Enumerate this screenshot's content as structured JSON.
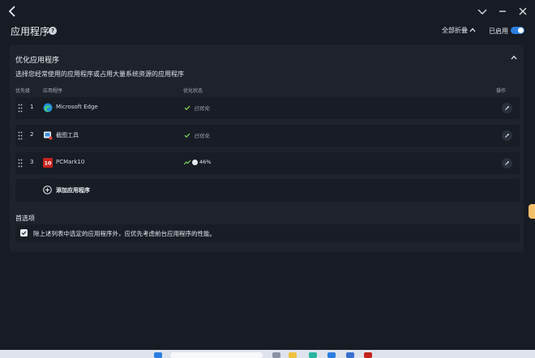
{
  "page": {
    "title": "应用程序",
    "collapse_all": "全部折叠",
    "enabled_label": "已启用"
  },
  "section": {
    "title": "优化应用程序",
    "subtitle": "选择您经常使用的应用程序或占用大量系统资源的应用程序"
  },
  "columns": {
    "priority": "优先级",
    "app": "应用程序",
    "status": "优化状态",
    "operation": "操作"
  },
  "rows": [
    {
      "num": "1",
      "name": "Microsoft Edge",
      "status": "已优化",
      "icon": "edge-icon"
    },
    {
      "num": "2",
      "name": "截图工具",
      "status": "已优化",
      "icon": "snipping-tool-icon"
    },
    {
      "num": "3",
      "name": "PCMark10",
      "status": "46%",
      "progress": 0.46,
      "icon": "pcmark10-icon"
    }
  ],
  "add_app": "添加应用程序",
  "preferences": {
    "title": "首选项",
    "option": "除上述列表中选定的应用程序外，应优先考虑前台应用程序的性能。",
    "checked": true
  },
  "colors": {
    "background": "#171b24",
    "panel": "#1d222c",
    "row": "#181c25",
    "accent": "#2b7ee0",
    "check_green": "#7fcf5a"
  }
}
